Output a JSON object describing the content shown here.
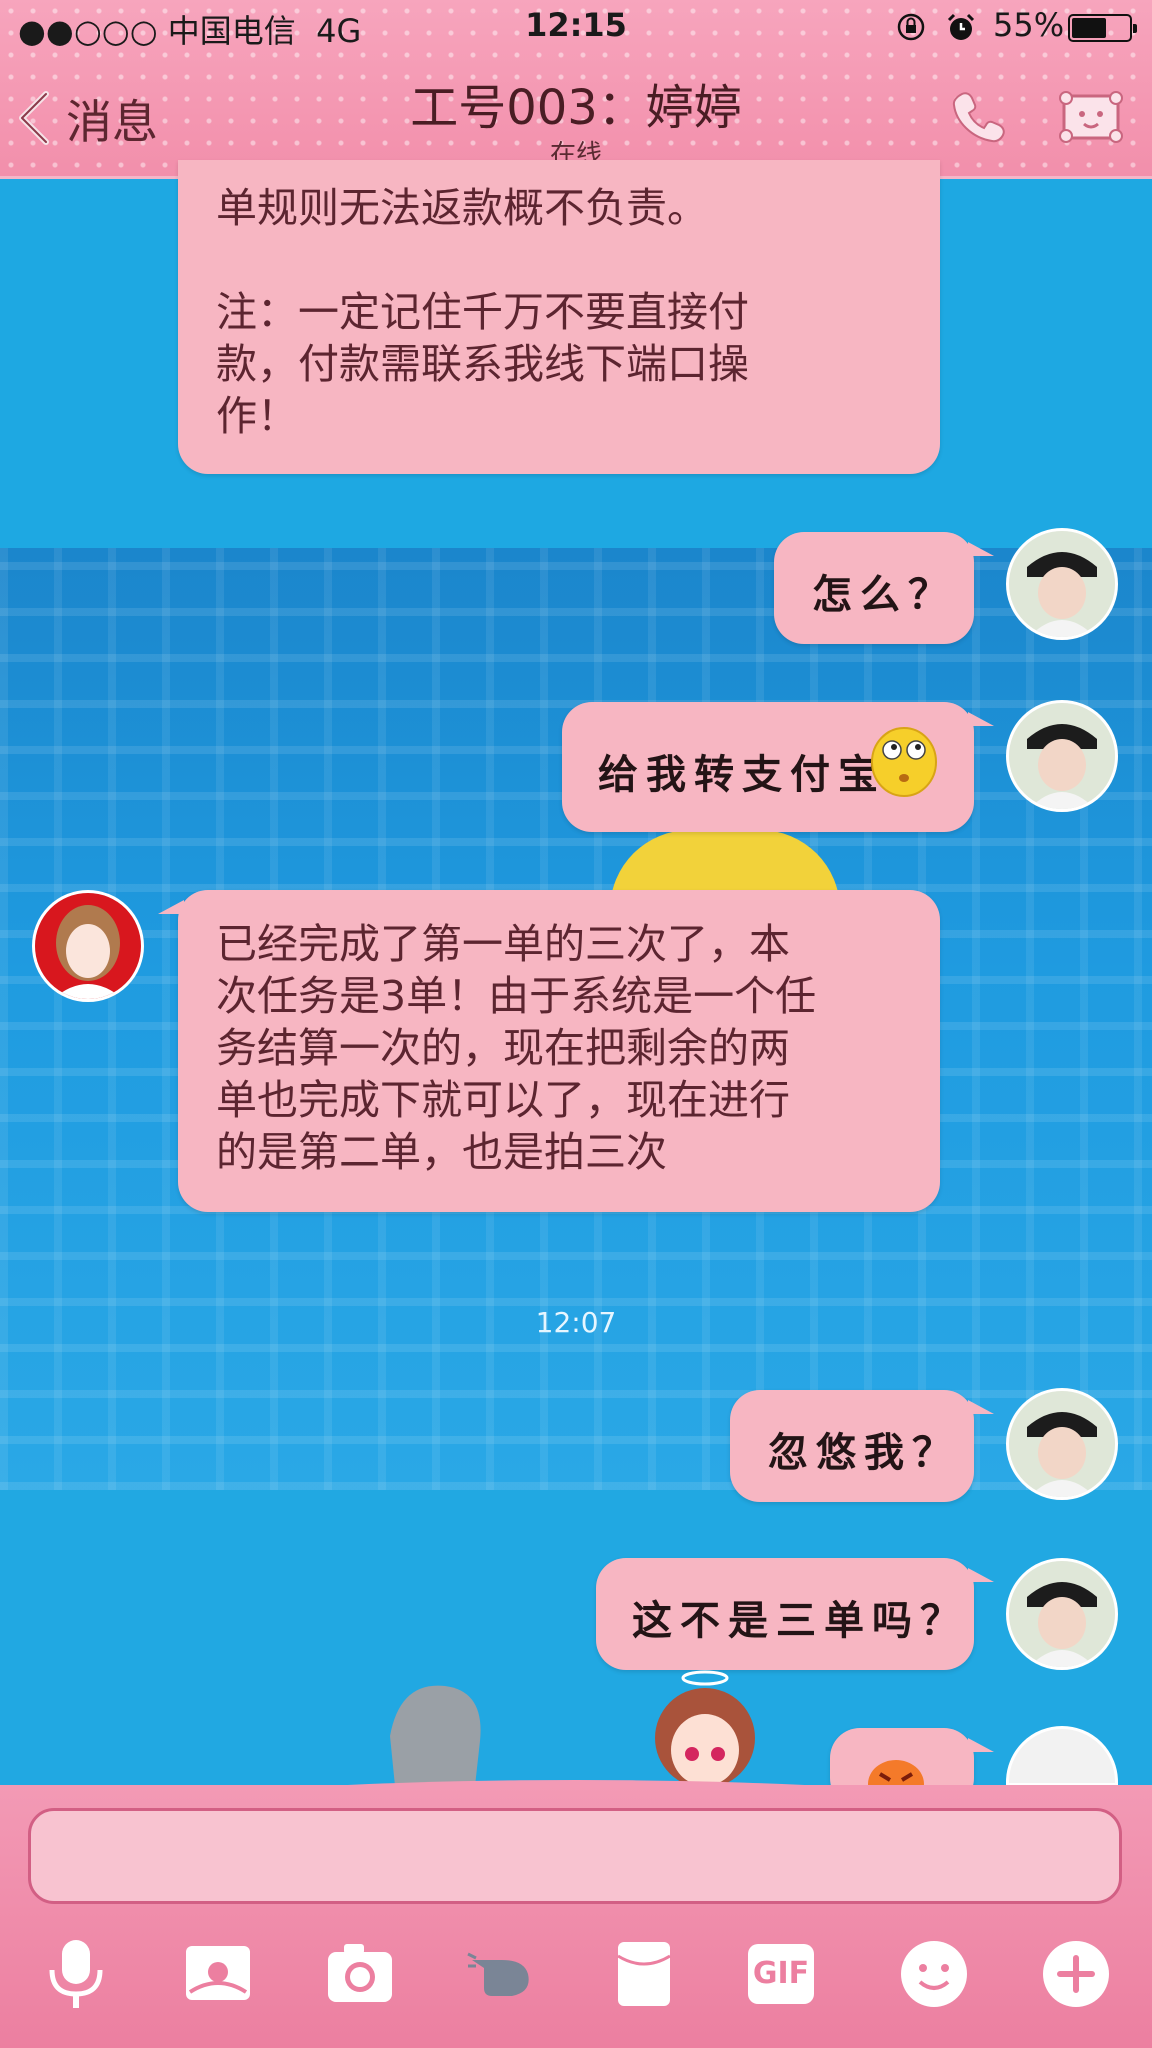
{
  "status_bar": {
    "carrier": "●●○○○ 中国电信  4G",
    "time": "12:15",
    "battery_pct": "55%"
  },
  "header": {
    "back_label": "消息",
    "title": "工号003：婷婷",
    "subtitle": "在线"
  },
  "messages": [
    {
      "side": "left",
      "text": "单规则无法返款概不负责。\n\n注：一定记住千万不要直接付\n款，付款需联系我线下端口操\n作！"
    },
    {
      "side": "right",
      "text": "怎么？"
    },
    {
      "side": "right",
      "text": "给我转支付宝"
    },
    {
      "side": "left",
      "text": "已经完成了第一单的三次了，本\n次任务是3单！由于系统是一个任\n务结算一次的，现在把剩余的两\n单也完成下就可以了，现在进行\n的是第二单，也是拍三次"
    },
    {
      "side": "right",
      "text": "忽悠我？"
    },
    {
      "side": "right",
      "text": "这不是三单吗？"
    }
  ],
  "timestamp": "12:07",
  "input": {
    "value": ""
  },
  "toolbar": {
    "icons": [
      "microphone-icon",
      "image-icon",
      "camera-icon",
      "poke-icon",
      "red-packet-icon",
      "gif-icon",
      "emoji-icon",
      "plus-icon"
    ],
    "gif_label": "GIF"
  },
  "colors": {
    "header": "#f28fab",
    "bubble": "#f7b6c2",
    "background": "#1ea8e2",
    "bottom_panel": "#ec7fa0"
  }
}
